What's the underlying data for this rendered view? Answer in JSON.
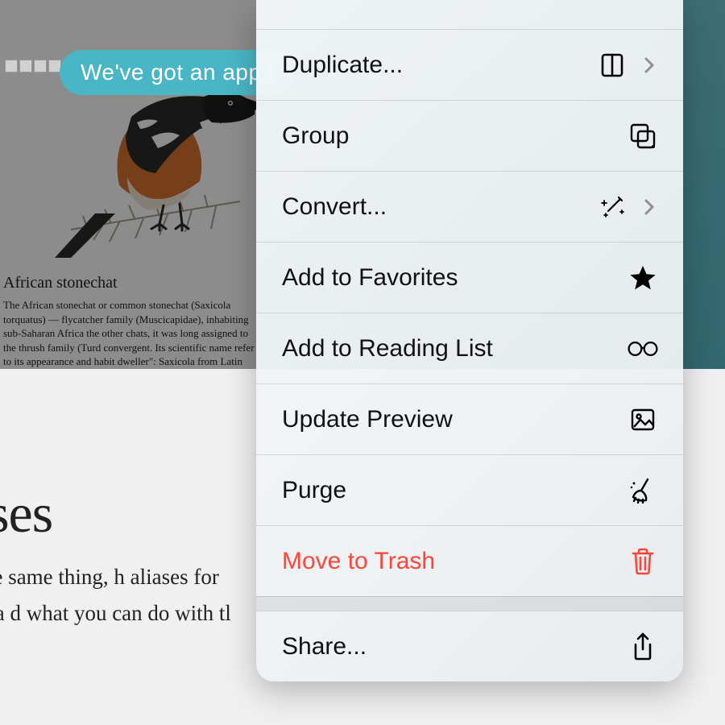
{
  "banner_text": "We've got an app f",
  "doc": {
    "title": "African stonechat",
    "body": "The African stonechat or common stonechat (Saxicola torquatus) — flycatcher family (Muscicapidae), inhabiting sub-Saharan Africa the other chats, it was long assigned to the thrush family (Turd convergent. Its scientific name refer to its appearance and habit dweller\": Saxicola from Latin saxum (\"rock\") + incola (\"one who"
  },
  "page": {
    "heading": "iases",
    "paragraph": "ames for the same thing, h aliases for documents a d what you can do with tl"
  },
  "menu": {
    "duplicate": "Duplicate...",
    "group": "Group",
    "convert": "Convert...",
    "favorites": "Add to Favorites",
    "reading": "Add to Reading List",
    "preview": "Update Preview",
    "purge": "Purge",
    "trash": "Move to Trash",
    "share": "Share..."
  },
  "colors": {
    "destructive": "#ff453a",
    "teal": "#49b6c6"
  }
}
